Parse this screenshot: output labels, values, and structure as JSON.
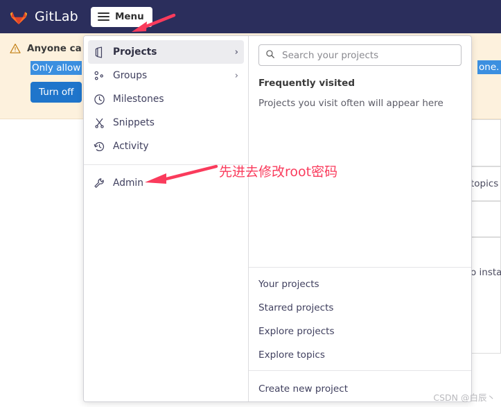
{
  "navbar": {
    "brand": "GitLab",
    "logo_icon": "gitlab-tanuki-icon",
    "menu_label": "Menu",
    "menu_icon": "hamburger-icon",
    "background_color": "#2b2e5c"
  },
  "alert": {
    "warning_icon": "warning-triangle-icon",
    "title": "Anyone ca",
    "highlighted_text": "Only allow",
    "highlighted_text_right": "one. A",
    "highlight_color": "#3b8fe0",
    "button_label": "Turn off",
    "button_color": "#1f75cb",
    "background_color": "#fdf1dd"
  },
  "background_page": {
    "cards": [
      {
        "text": "topics"
      },
      {
        "text": "o instan"
      }
    ]
  },
  "dropdown": {
    "nav_items": [
      {
        "label": "Projects",
        "icon": "project-icon",
        "chevron": "›",
        "active": true
      },
      {
        "label": "Groups",
        "icon": "groups-icon",
        "chevron": "›",
        "active": false
      },
      {
        "label": "Milestones",
        "icon": "clock-icon",
        "chevron": "",
        "active": false
      },
      {
        "label": "Snippets",
        "icon": "scissors-icon",
        "chevron": "",
        "active": false
      },
      {
        "label": "Activity",
        "icon": "history-icon",
        "chevron": "",
        "active": false
      }
    ],
    "admin_item": {
      "label": "Admin",
      "icon": "wrench-icon"
    },
    "search": {
      "placeholder": "Search your projects",
      "value": "",
      "icon": "search-icon"
    },
    "frequently_visited_title": "Frequently visited",
    "frequently_visited_note": "Projects you visit often will appear here",
    "links": [
      {
        "label": "Your projects"
      },
      {
        "label": "Starred projects"
      },
      {
        "label": "Explore projects"
      },
      {
        "label": "Explore topics"
      }
    ],
    "create_link": {
      "label": "Create new project"
    }
  },
  "annotations": {
    "arrow_menu": "arrow-pointing-to-menu-button",
    "arrow_admin": "arrow-pointing-to-admin-item",
    "note_text": "先进去修改root密码",
    "color": "#fa3b5c"
  },
  "watermark": "CSDN @白辰丶"
}
